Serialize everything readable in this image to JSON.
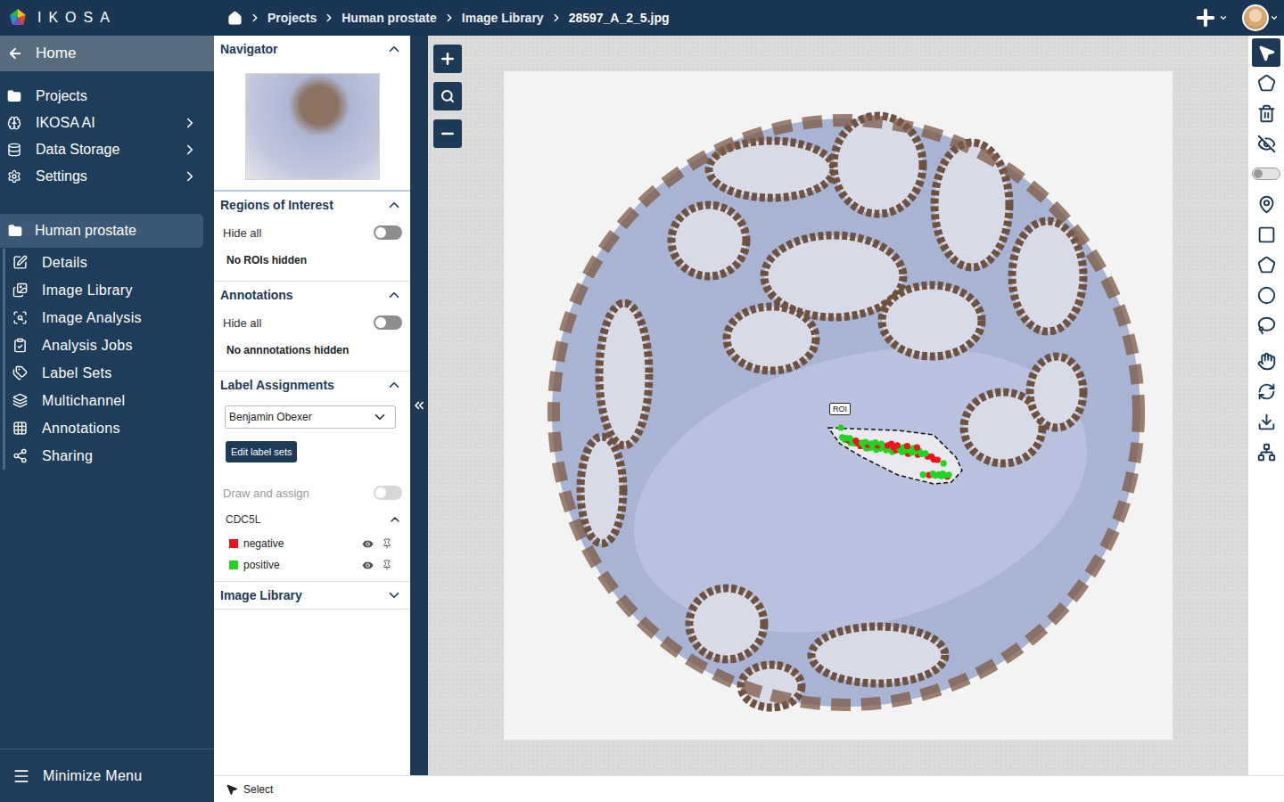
{
  "app": {
    "logo": "IKOSA"
  },
  "breadcrumbs": [
    {
      "label": "Projects",
      "current": false
    },
    {
      "label": "Human prostate",
      "current": false
    },
    {
      "label": "Image Library",
      "current": false
    },
    {
      "label": "28597_A_2_5.jpg",
      "current": true
    }
  ],
  "sidebar": {
    "back": "Home",
    "items": [
      {
        "label": "Projects",
        "has_submenu": false
      },
      {
        "label": "IKOSA AI",
        "has_submenu": true
      },
      {
        "label": "Data Storage",
        "has_submenu": true
      },
      {
        "label": "Settings",
        "has_submenu": true
      }
    ],
    "project": {
      "label": "Human prostate",
      "selected": true
    },
    "project_items": [
      {
        "label": "Details"
      },
      {
        "label": "Image Library"
      },
      {
        "label": "Image Analysis"
      },
      {
        "label": "Analysis Jobs"
      },
      {
        "label": "Label Sets"
      },
      {
        "label": "Multichannel"
      },
      {
        "label": "Annotations"
      },
      {
        "label": "Sharing"
      }
    ],
    "footer": "Minimize Menu"
  },
  "panel": {
    "navigator": {
      "title": "Navigator",
      "expanded": true
    },
    "regions_of_interest": {
      "title": "Regions of Interest",
      "expanded": true,
      "hide_all": {
        "label": "Hide all",
        "on": false
      },
      "status": "No ROIs hidden"
    },
    "annotations": {
      "title": "Annotations",
      "expanded": true,
      "hide_all": {
        "label": "Hide all",
        "on": false
      },
      "status": "No annnotations hidden"
    },
    "label_assignments": {
      "title": "Label Assignments",
      "expanded": true,
      "user": "Benjamin Obexer",
      "edit_button": "Edit label sets",
      "draw_and_assign": {
        "label": "Draw and assign",
        "on": false,
        "disabled": true
      },
      "label_set": {
        "name": "CDC5L",
        "expanded": true,
        "labels": [
          {
            "name": "negative",
            "color": "#e8161b",
            "visible": true
          },
          {
            "name": "positive",
            "color": "#22d422",
            "visible": true
          }
        ]
      }
    },
    "image_library": {
      "title": "Image Library",
      "expanded": false
    }
  },
  "canvas": {
    "roi": {
      "label": "ROI"
    }
  },
  "toolbar": [
    {
      "kind": "button",
      "selected": true
    },
    {
      "kind": "button",
      "selected": false
    },
    {
      "kind": "button",
      "selected": false
    },
    {
      "kind": "button",
      "selected": false
    },
    {
      "kind": "switch",
      "on": false
    },
    {
      "kind": "button",
      "selected": false
    },
    {
      "kind": "button",
      "selected": false
    },
    {
      "kind": "button",
      "selected": false
    },
    {
      "kind": "button",
      "selected": false
    },
    {
      "kind": "button",
      "selected": false
    },
    {
      "kind": "button",
      "selected": false
    },
    {
      "kind": "button",
      "selected": false
    },
    {
      "kind": "button",
      "selected": false
    },
    {
      "kind": "button",
      "selected": false
    }
  ],
  "status_bar": {
    "tool": "Select"
  }
}
